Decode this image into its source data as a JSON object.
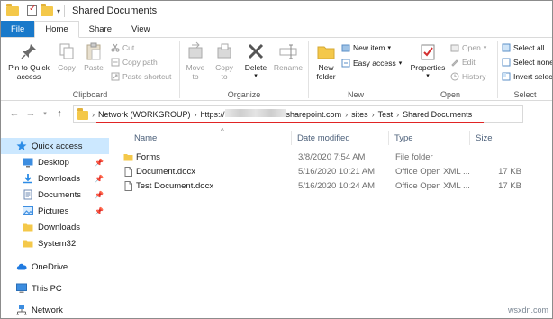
{
  "window": {
    "title": "Shared Documents"
  },
  "tabs": [
    {
      "label": "File"
    },
    {
      "label": "Home"
    },
    {
      "label": "Share"
    },
    {
      "label": "View"
    }
  ],
  "ribbon": {
    "clipboard": {
      "label": "Clipboard",
      "pin": "Pin to Quick access",
      "pin_line1": "Pin to Quick",
      "pin_line2": "access",
      "copy": "Copy",
      "paste": "Paste",
      "cut": "Cut",
      "copy_path": "Copy path",
      "paste_shortcut": "Paste shortcut"
    },
    "organize": {
      "label": "Organize",
      "move_to_1": "Move",
      "move_to_2": "to",
      "copy_to_1": "Copy",
      "copy_to_2": "to",
      "delete": "Delete",
      "rename": "Rename"
    },
    "new": {
      "label": "New",
      "new_folder_1": "New",
      "new_folder_2": "folder",
      "new_item": "New item",
      "easy_access": "Easy access"
    },
    "open": {
      "label": "Open",
      "properties": "Properties",
      "open": "Open",
      "edit": "Edit",
      "history": "History"
    },
    "select": {
      "label": "Select",
      "select_all": "Select all",
      "select_none": "Select none",
      "invert": "Invert selecti"
    }
  },
  "address": {
    "crumbs": [
      {
        "text": "Network (WORKGROUP)"
      },
      {
        "text": "https://"
      },
      {
        "text": "sharepoint.com"
      },
      {
        "text": "sites"
      },
      {
        "text": "Test"
      },
      {
        "text": "Shared Documents"
      }
    ]
  },
  "navpane": {
    "items": [
      {
        "label": "Quick access"
      },
      {
        "label": "Desktop"
      },
      {
        "label": "Downloads"
      },
      {
        "label": "Documents"
      },
      {
        "label": "Pictures"
      },
      {
        "label": "Downloads"
      },
      {
        "label": "System32"
      },
      {
        "label": "OneDrive"
      },
      {
        "label": "This PC"
      },
      {
        "label": "Network"
      }
    ]
  },
  "filelist": {
    "columns": {
      "name": "Name",
      "date": "Date modified",
      "type": "Type",
      "size": "Size"
    },
    "rows": [
      {
        "name": "Forms",
        "date": "3/8/2020 7:54 AM",
        "type": "File folder",
        "size": ""
      },
      {
        "name": "Document.docx",
        "date": "5/16/2020 10:21 AM",
        "type": "Office Open XML ...",
        "size": "17 KB"
      },
      {
        "name": "Test Document.docx",
        "date": "5/16/2020 10:24 AM",
        "type": "Office Open XML ...",
        "size": "17 KB"
      }
    ]
  },
  "watermark": "wsxdn.com",
  "colors": {
    "file_tab": "#1979ca",
    "selection": "#cce8ff",
    "underline": "#e02424",
    "folder": "#f4c84a"
  }
}
